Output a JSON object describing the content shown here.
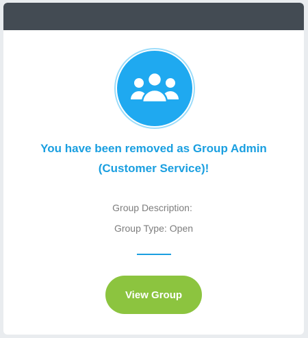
{
  "notification": {
    "title_line1": "You have been removed as Group Admin",
    "title_line2": "(Customer Service)!",
    "group_description_label": "Group Description:",
    "group_description_value": "",
    "group_type_label": "Group Type:",
    "group_type_value": "Open",
    "view_group_label": "View Group"
  },
  "icon": {
    "name": "group-icon",
    "background": "#1fa9f0"
  },
  "colors": {
    "header": "#434b53",
    "accent": "#1a9fe0",
    "button": "#8cc43f"
  }
}
